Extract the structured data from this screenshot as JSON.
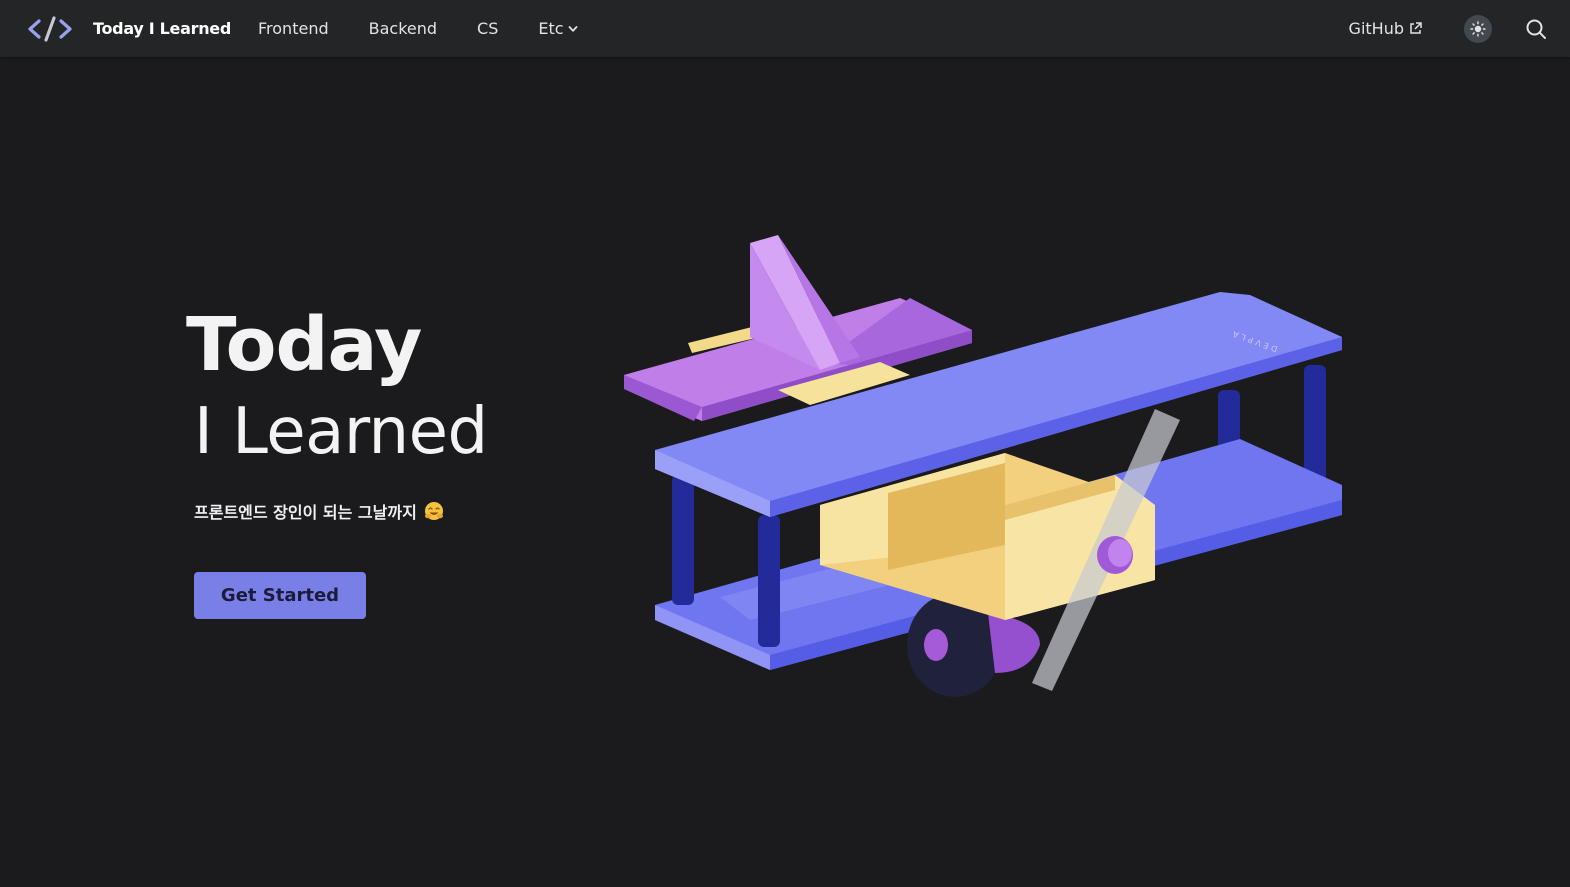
{
  "navbar": {
    "brand_title": "Today I Learned",
    "links": [
      {
        "label": "Frontend"
      },
      {
        "label": "Backend"
      },
      {
        "label": "CS"
      },
      {
        "label": "Etc",
        "has_dropdown": true
      }
    ],
    "github_label": "GitHub",
    "icons": {
      "logo": "code-brackets-icon",
      "external": "external-link-icon",
      "theme": "sun-icon",
      "search": "search-icon"
    }
  },
  "hero": {
    "title_line1": "Today",
    "title_line2": "I Learned",
    "subtitle": "프론트엔드 장인이 되는 그날까지",
    "subtitle_emoji": "smiling-face-emoji",
    "cta_label": "Get Started",
    "illustration": "toy-biplane-illustration",
    "illustration_text": "DEVPLA"
  },
  "colors": {
    "background": "#1b1b1d",
    "navbar": "#242526",
    "accent": "#7a7fe8",
    "text": "#e3e3e3"
  }
}
